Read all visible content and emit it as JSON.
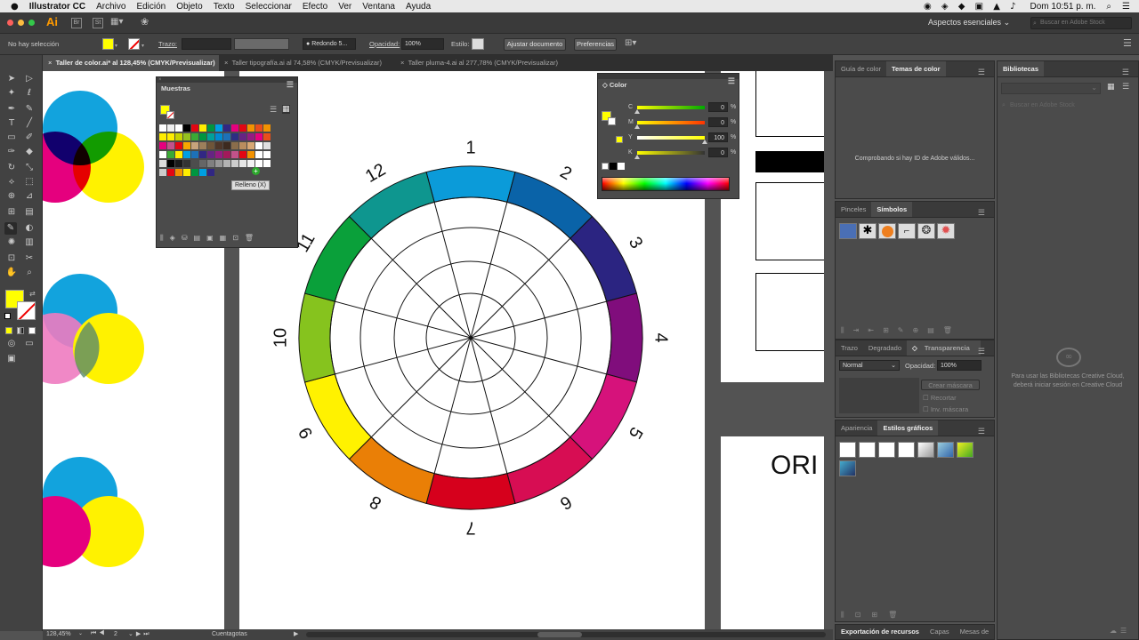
{
  "menubar": {
    "app": "Illustrator CC",
    "items": [
      "Archivo",
      "Edición",
      "Objeto",
      "Texto",
      "Seleccionar",
      "Efecto",
      "Ver",
      "Ventana",
      "Ayuda"
    ],
    "clock": "Dom 10:51 p. m."
  },
  "appbar": {
    "logo": "Ai",
    "br": "Br",
    "st": "St",
    "workspace": "Aspectos esenciales",
    "stock_placeholder": "Buscar en Adobe Stock"
  },
  "controlbar": {
    "selection": "No hay selección",
    "stroke_label": "Trazo:",
    "brush": "Redondo 5...",
    "opacity_label": "Opacidad:",
    "opacity": "100%",
    "style_label": "Estilo:",
    "doc_setup": "Ajustar documento",
    "prefs": "Preferencias",
    "colors": {
      "fill": "#ffff00"
    }
  },
  "tabs": [
    "Taller de color.ai* al 128,45% (CMYK/Previsualizar)",
    "Taller tipografía.ai al 74,58% (CMYK/Previsualizar)",
    "Taller pluma-4.ai al 277,78% (CMYK/Previsualizar)"
  ],
  "muestras": {
    "title": "Muestras",
    "tooltip": "Relleno (X)"
  },
  "color": {
    "title": "Color",
    "sliders": [
      {
        "label": "C",
        "value": "0"
      },
      {
        "label": "M",
        "value": "0"
      },
      {
        "label": "Y",
        "value": "100"
      },
      {
        "label": "K",
        "value": "0"
      }
    ],
    "unit": "%"
  },
  "wheel": {
    "numbers": [
      "1",
      "2",
      "3",
      "4",
      "5",
      "6",
      "7",
      "8",
      "9",
      "10",
      "11",
      "12"
    ],
    "colors": [
      "#0b9bd9",
      "#0a63a8",
      "#2b2481",
      "#800d7c",
      "#d6127b",
      "#d70d53",
      "#d6001c",
      "#ea7f06",
      "#fff200",
      "#86c31e",
      "#0aa03a",
      "#0e968f"
    ]
  },
  "canvas": {
    "ori": "ORI"
  },
  "right": {
    "tabs1": [
      "Guía de color",
      "Temas de color"
    ],
    "themes_msg": "Comprobando si hay ID de Adobe válidos...",
    "tabs2": [
      "Pinceles",
      "Símbolos"
    ],
    "tabs3": [
      "Trazo",
      "Degradado",
      "Transparencia"
    ],
    "blend": "Normal",
    "opacity_label": "Opacidad:",
    "opacity": "100%",
    "mask_btn": "Crear máscara",
    "clip": "Recortar",
    "invert": "Inv. máscara",
    "tabs4": [
      "Apariencia",
      "Estilos gráficos"
    ],
    "tabs5": [
      "Exportación de recursos",
      "Capas",
      "Mesas de"
    ]
  },
  "libraries": {
    "title": "Bibliotecas",
    "search_placeholder": "Buscar en Adobe Stock",
    "msg1": "Para usar las Bibliotecas Creative Cloud,",
    "msg2": "deberá iniciar sesión en Creative Cloud"
  },
  "status": {
    "zoom": "128,45%",
    "page": "2",
    "tool": "Cuentagotas"
  }
}
